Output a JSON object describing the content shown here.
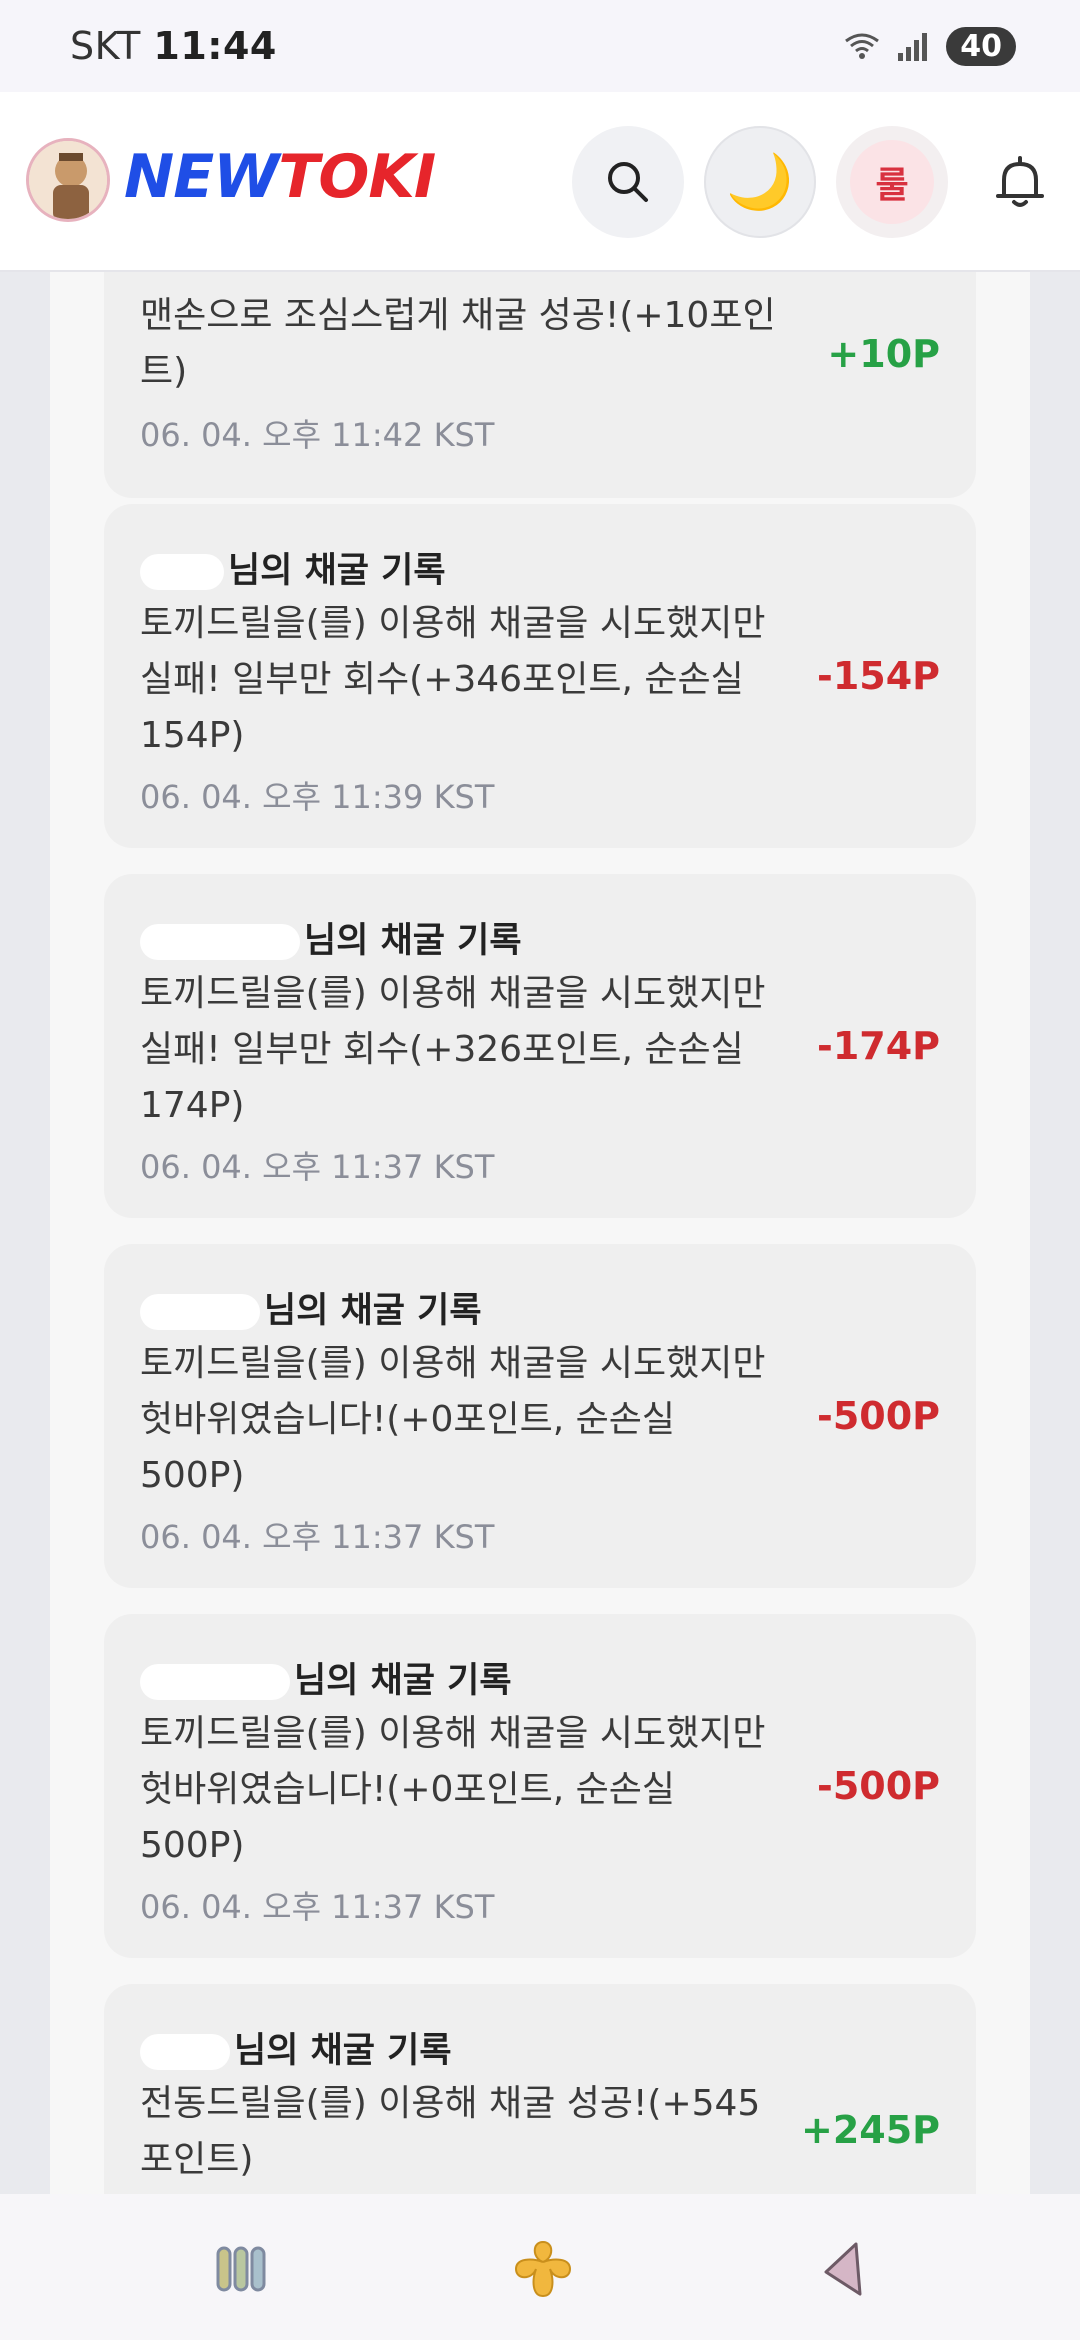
{
  "status_bar": {
    "carrier": "SKT",
    "time": "11:44",
    "battery": "40",
    "icons": [
      "wifi-icon",
      "signal-icon",
      "battery-icon"
    ]
  },
  "header": {
    "logo_part1": "NEW",
    "logo_part2": "TOKI",
    "rule_button_label": "룰",
    "icons": [
      "avatar-logo",
      "search-icon",
      "moon-icon",
      "bell-icon"
    ],
    "colors": {
      "logo_blue": "#1f4ee6",
      "logo_red": "#e6252b",
      "positive": "#27a146",
      "negative": "#cf2b2f"
    }
  },
  "records": [
    {
      "title": "",
      "message": "맨손으로 조심스럽게 채굴 성공!(+10포인트)",
      "time": "06. 04. 오후 11:42 KST",
      "amount": "+10P",
      "sign": "plus"
    },
    {
      "title": "님의 채굴 기록",
      "message": "토끼드릴을(를) 이용해 채굴을 시도했지만 실패! 일부만 회수(+346포인트, 순손실 154P)",
      "time": "06. 04. 오후 11:39 KST",
      "amount": "-154P",
      "sign": "minus"
    },
    {
      "title": "님의 채굴 기록",
      "message": "토끼드릴을(를) 이용해 채굴을 시도했지만 실패! 일부만 회수(+326포인트, 순손실 174P)",
      "time": "06. 04. 오후 11:37 KST",
      "amount": "-174P",
      "sign": "minus"
    },
    {
      "title": "님의 채굴 기록",
      "message": "토끼드릴을(를) 이용해 채굴을 시도했지만 헛바위였습니다!(+0포인트, 순손실 500P)",
      "time": "06. 04. 오후 11:37 KST",
      "amount": "-500P",
      "sign": "minus"
    },
    {
      "title": "님의 채굴 기록",
      "message": "토끼드릴을(를) 이용해 채굴을 시도했지만 헛바위였습니다!(+0포인트, 순손실 500P)",
      "time": "06. 04. 오후 11:37 KST",
      "amount": "-500P",
      "sign": "minus"
    },
    {
      "title": "님의 채굴 기록",
      "message": "전동드릴을(를) 이용해 채굴 성공!(+545포인트)",
      "time": "",
      "amount": "+245P",
      "sign": "plus"
    }
  ],
  "bottom_nav": {
    "icons": [
      "recent-apps-icon",
      "home-icon",
      "back-icon"
    ]
  }
}
